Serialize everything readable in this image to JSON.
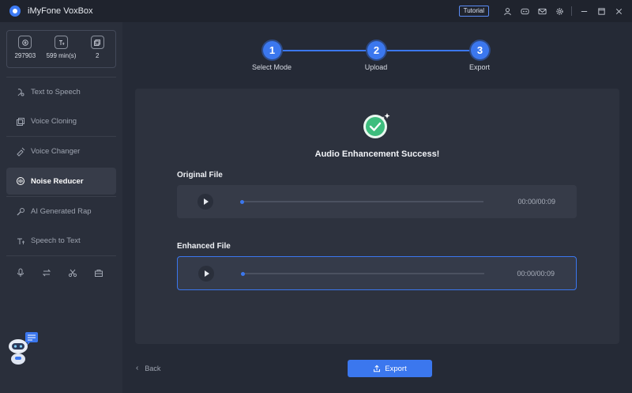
{
  "app": {
    "title": "iMyFone VoxBox"
  },
  "toolbar": {
    "tutorial_label": "Tutorial"
  },
  "stats": [
    {
      "icon": "character-count-icon",
      "value": "297903"
    },
    {
      "icon": "text-minutes-icon",
      "value": "599 min(s)"
    },
    {
      "icon": "copy-count-icon",
      "value": "2"
    }
  ],
  "nav": {
    "items": [
      {
        "icon": "microphone-text-icon",
        "label": "Text to Speech"
      },
      {
        "icon": "voice-clone-icon",
        "label": "Voice Cloning"
      },
      {
        "icon": "voice-changer-icon",
        "label": "Voice Changer"
      },
      {
        "icon": "noise-reducer-icon",
        "label": "Noise Reducer"
      },
      {
        "icon": "rap-icon",
        "label": "AI Generated Rap"
      },
      {
        "icon": "speech-text-icon",
        "label": "Speech to Text"
      }
    ],
    "active_index": 3
  },
  "steps": [
    {
      "number": "1",
      "label": "Select Mode"
    },
    {
      "number": "2",
      "label": "Upload"
    },
    {
      "number": "3",
      "label": "Export"
    }
  ],
  "result": {
    "title": "Audio Enhancement Success!"
  },
  "original": {
    "label": "Original File",
    "time": "00:00/00:09",
    "progress": 0
  },
  "enhanced": {
    "label": "Enhanced File",
    "time": "00:00/00:09",
    "progress": 0
  },
  "footer": {
    "back_label": "Back",
    "export_label": "Export"
  },
  "colors": {
    "accent": "#3b77ee",
    "success": "#3dbd7d",
    "background": "#252a36"
  }
}
